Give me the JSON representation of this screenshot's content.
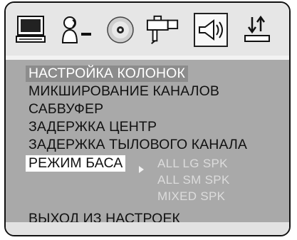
{
  "tabs": [
    {
      "icon": "monitor-icon",
      "active": false
    },
    {
      "icon": "speaker-person-icon",
      "active": false
    },
    {
      "icon": "disc-icon",
      "active": false
    },
    {
      "icon": "camera-icon",
      "active": false
    },
    {
      "icon": "speaker-audio-icon",
      "active": true
    },
    {
      "icon": "sort-arrows-icon",
      "active": false
    }
  ],
  "menu": {
    "items": [
      "НАСТРОЙКА КОЛОНОК",
      "МИКШИРОВАНИЕ КАНАЛОВ",
      "САБВУФЕР",
      "ЗАДЕРЖКА ЦЕНТР",
      "ЗАДЕРЖКА ТЫЛОВОГО КАНАЛА",
      "РЕЖИМ БАСА"
    ],
    "bass_options": [
      "ALL LG SPK",
      "ALL SM SPK",
      "MIXED SPK"
    ],
    "exit_label": "ВЫХОД ИЗ НАСТРОЕК"
  },
  "colors": {
    "menu_bg": "#a9a9a9",
    "highlight_bg": "#8c8c8c",
    "option_text": "#dcdcdc"
  }
}
